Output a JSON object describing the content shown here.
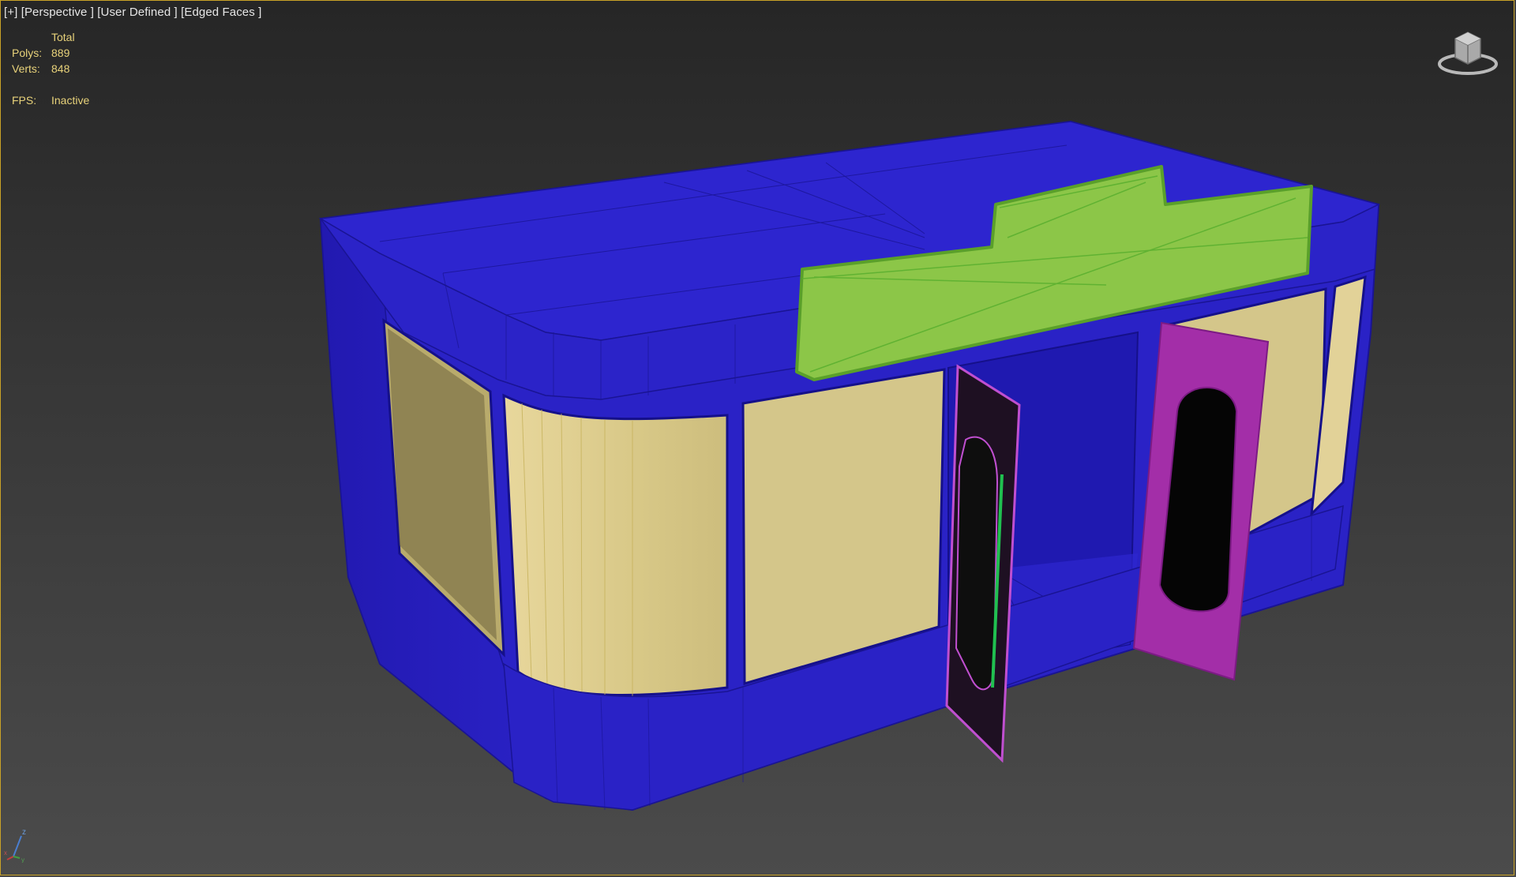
{
  "viewport": {
    "labels": [
      "[+]",
      "[Perspective ]",
      "[User Defined ]",
      "[Edged Faces ]"
    ]
  },
  "stats": {
    "header": "Total",
    "polys_label": "Polys:",
    "polys_value": "889",
    "verts_label": "Verts:",
    "verts_value": "848",
    "fps_label": "FPS:",
    "fps_value": "Inactive"
  },
  "colors": {
    "border_active": "#c9a227",
    "body_blue": "#2a22c6",
    "window_yellow": "#d4c68a",
    "sign_green": "#8cc648",
    "door_purple": "#a32ea8",
    "stats_text": "#e8d27a"
  },
  "icons": {
    "viewcube": "viewcube-icon",
    "axis_gizmo": "axis-tripod-icon"
  },
  "axis": {
    "z": "z",
    "x": "x",
    "y": "y"
  }
}
